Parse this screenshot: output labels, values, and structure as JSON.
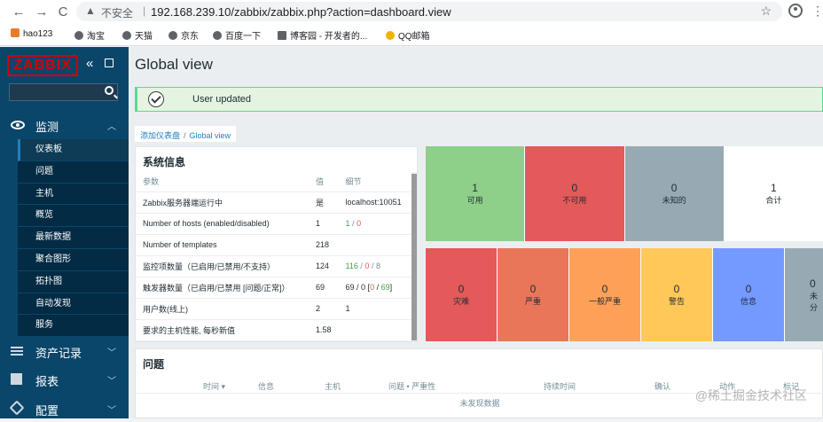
{
  "browser": {
    "back": "←",
    "forward": "→",
    "reload": "C",
    "insecure_label": "不安全",
    "url": "192.168.239.10/zabbix/zabbix.php?action=dashboard.view",
    "bookmarks": [
      "hao123",
      "淘宝",
      "天猫",
      "京东",
      "百度一下",
      "博客园 - 开发者的...",
      "QQ邮箱"
    ]
  },
  "sidebar": {
    "logo": "ZABBIX",
    "search_placeholder": "",
    "monitor_label": "监测",
    "submenu": [
      "仪表板",
      "问题",
      "主机",
      "概览",
      "最新数据",
      "聚合图形",
      "拓扑图",
      "自动发现",
      "服务"
    ],
    "assets_label": "资产记录",
    "reports_label": "报表",
    "config_label": "配置"
  },
  "main": {
    "title": "Global view",
    "message": "User updated",
    "breadcrumb": [
      "添加仪表盘",
      "Global view"
    ]
  },
  "sysinfo": {
    "title": "系统信息",
    "headers": [
      "参数",
      "值",
      "细节"
    ],
    "rows": [
      {
        "param": "Zabbix服务器端运行中",
        "value": "是",
        "detail": "localhost:10051"
      },
      {
        "param": "Number of hosts (enabled/disabled)",
        "value": "1",
        "detail_a": "1",
        "detail_b": "0"
      },
      {
        "param": "Number of templates",
        "value": "218",
        "detail": ""
      },
      {
        "param": "监控项数量（已启用/已禁用/不支持）",
        "value": "124",
        "detail_a": "116",
        "detail_b": "0",
        "detail_c": "8"
      },
      {
        "param": "触发器数量（已启用/已禁用 [问题/正常]）",
        "value": "69",
        "detail_a": "69 / 0 [",
        "detail_b": "0",
        "detail_c": "69",
        "detail_d": "]"
      },
      {
        "param": "用户数(线上)",
        "value": "2",
        "detail": "1"
      },
      {
        "param": "要求的主机性能, 每秒新值",
        "value": "1.58",
        "detail": ""
      }
    ]
  },
  "host_availability": [
    {
      "count": "1",
      "label": "可用",
      "color": "#8ecf8a"
    },
    {
      "count": "0",
      "label": "不可用",
      "color": "#e45959"
    },
    {
      "count": "0",
      "label": "未知的",
      "color": "#97aab3"
    },
    {
      "count": "1",
      "label": "合计",
      "color": "#ffffff"
    }
  ],
  "severity": [
    {
      "count": "0",
      "label": "灾难",
      "color": "#e45959"
    },
    {
      "count": "0",
      "label": "严重",
      "color": "#e97659"
    },
    {
      "count": "0",
      "label": "一般严重",
      "color": "#ffa059"
    },
    {
      "count": "0",
      "label": "警告",
      "color": "#ffc859"
    },
    {
      "count": "0",
      "label": "信息",
      "color": "#7499ff"
    },
    {
      "count": "0",
      "label": "未分",
      "color": "#97aab3"
    }
  ],
  "problems": {
    "title": "问题",
    "headers": [
      "时间 ▾",
      "信息",
      "主机",
      "问题 • 严重性",
      "持续时间",
      "确认",
      "动作",
      "标记"
    ],
    "empty": "未发现数据"
  },
  "watermark": "@稀土掘金技术社区"
}
